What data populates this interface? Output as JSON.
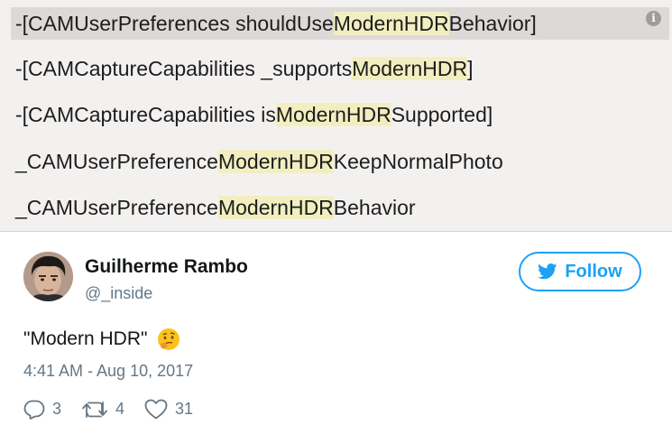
{
  "results": [
    {
      "segments": [
        {
          "text": "-[CAMUserPreferences shouldUse",
          "hl": false
        },
        {
          "text": "ModernHDR",
          "hl": true
        },
        {
          "text": "Behavior]",
          "hl": false
        }
      ],
      "selected": true
    },
    {
      "segments": [
        {
          "text": "-[CAMCaptureCapabilities _supports",
          "hl": false
        },
        {
          "text": "ModernHDR",
          "hl": true
        },
        {
          "text": "]",
          "hl": false
        }
      ],
      "selected": false
    },
    {
      "segments": [
        {
          "text": "-[CAMCaptureCapabilities is",
          "hl": false
        },
        {
          "text": "ModernHDR",
          "hl": true
        },
        {
          "text": "Supported]",
          "hl": false
        }
      ],
      "selected": false
    },
    {
      "segments": [
        {
          "text": "_CAMUserPreference",
          "hl": false
        },
        {
          "text": "ModernHDR",
          "hl": true
        },
        {
          "text": "KeepNormalPhoto",
          "hl": false
        }
      ],
      "selected": false
    },
    {
      "segments": [
        {
          "text": "_CAMUserPreference",
          "hl": false
        },
        {
          "text": "ModernHDR",
          "hl": true
        },
        {
          "text": "Behavior",
          "hl": false
        }
      ],
      "selected": false
    }
  ],
  "info_label": "i",
  "tweet": {
    "author_name": "Guilherme Rambo",
    "author_handle": "@_inside",
    "follow_label": "Follow",
    "text": "\"Modern HDR\"",
    "emoji": "thinking-face",
    "timestamp": "4:41 AM - Aug 10, 2017",
    "replies": "3",
    "retweets": "4",
    "likes": "31"
  },
  "colors": {
    "accent": "#1da1f2",
    "highlight": "#f2eec0",
    "muted": "#657786",
    "panel": "#f3f1f0"
  },
  "icons": [
    "info-icon",
    "twitter-bird-icon",
    "reply-icon",
    "retweet-icon",
    "heart-icon",
    "thinking-face-emoji"
  ]
}
